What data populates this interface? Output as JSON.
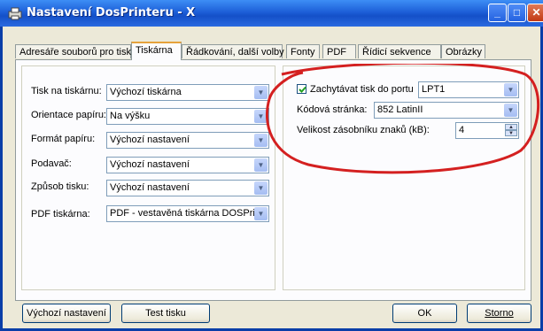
{
  "window": {
    "title": "Nastavení DosPrinteru  - X"
  },
  "titlebar_buttons": [
    "_",
    "□",
    "✕"
  ],
  "tabs": [
    "Adresáře souborů pro tisk",
    "Tiskárna",
    "Řádkování, další volby",
    "Fonty",
    "PDF",
    "Řídicí sekvence",
    "Obrázky"
  ],
  "left": {
    "printer": {
      "label": "Tisk na tiskárnu:",
      "value": "Výchozí tiskárna"
    },
    "orientation": {
      "label": "Orientace papíru:",
      "value": "Na výšku"
    },
    "paper_format": {
      "label": "Formát papíru:",
      "value": "Výchozí nastavení"
    },
    "feeder": {
      "label": "Podavač:",
      "value": "Výchozí nastavení"
    },
    "print_mode": {
      "label": "Způsob tisku:",
      "value": "Výchozí nastavení"
    },
    "pdf_printer": {
      "label": "PDF tiskárna:",
      "value": "PDF - vestavěná tiskárna DOSPrin"
    }
  },
  "right": {
    "capture": {
      "label": "Zachytávat tisk do portu",
      "checked": true,
      "port": "LPT1"
    },
    "codepage": {
      "label": "Kódová stránka:",
      "value": "852 LatinII"
    },
    "buffer": {
      "label": "Velikost zásobníku znaků (kB):",
      "value": "4"
    }
  },
  "buttons": {
    "defaults": "Výchozí nastavení",
    "test": "Test tisku",
    "ok": "OK",
    "cancel": "Storno"
  },
  "annotation_color": "#d42020"
}
